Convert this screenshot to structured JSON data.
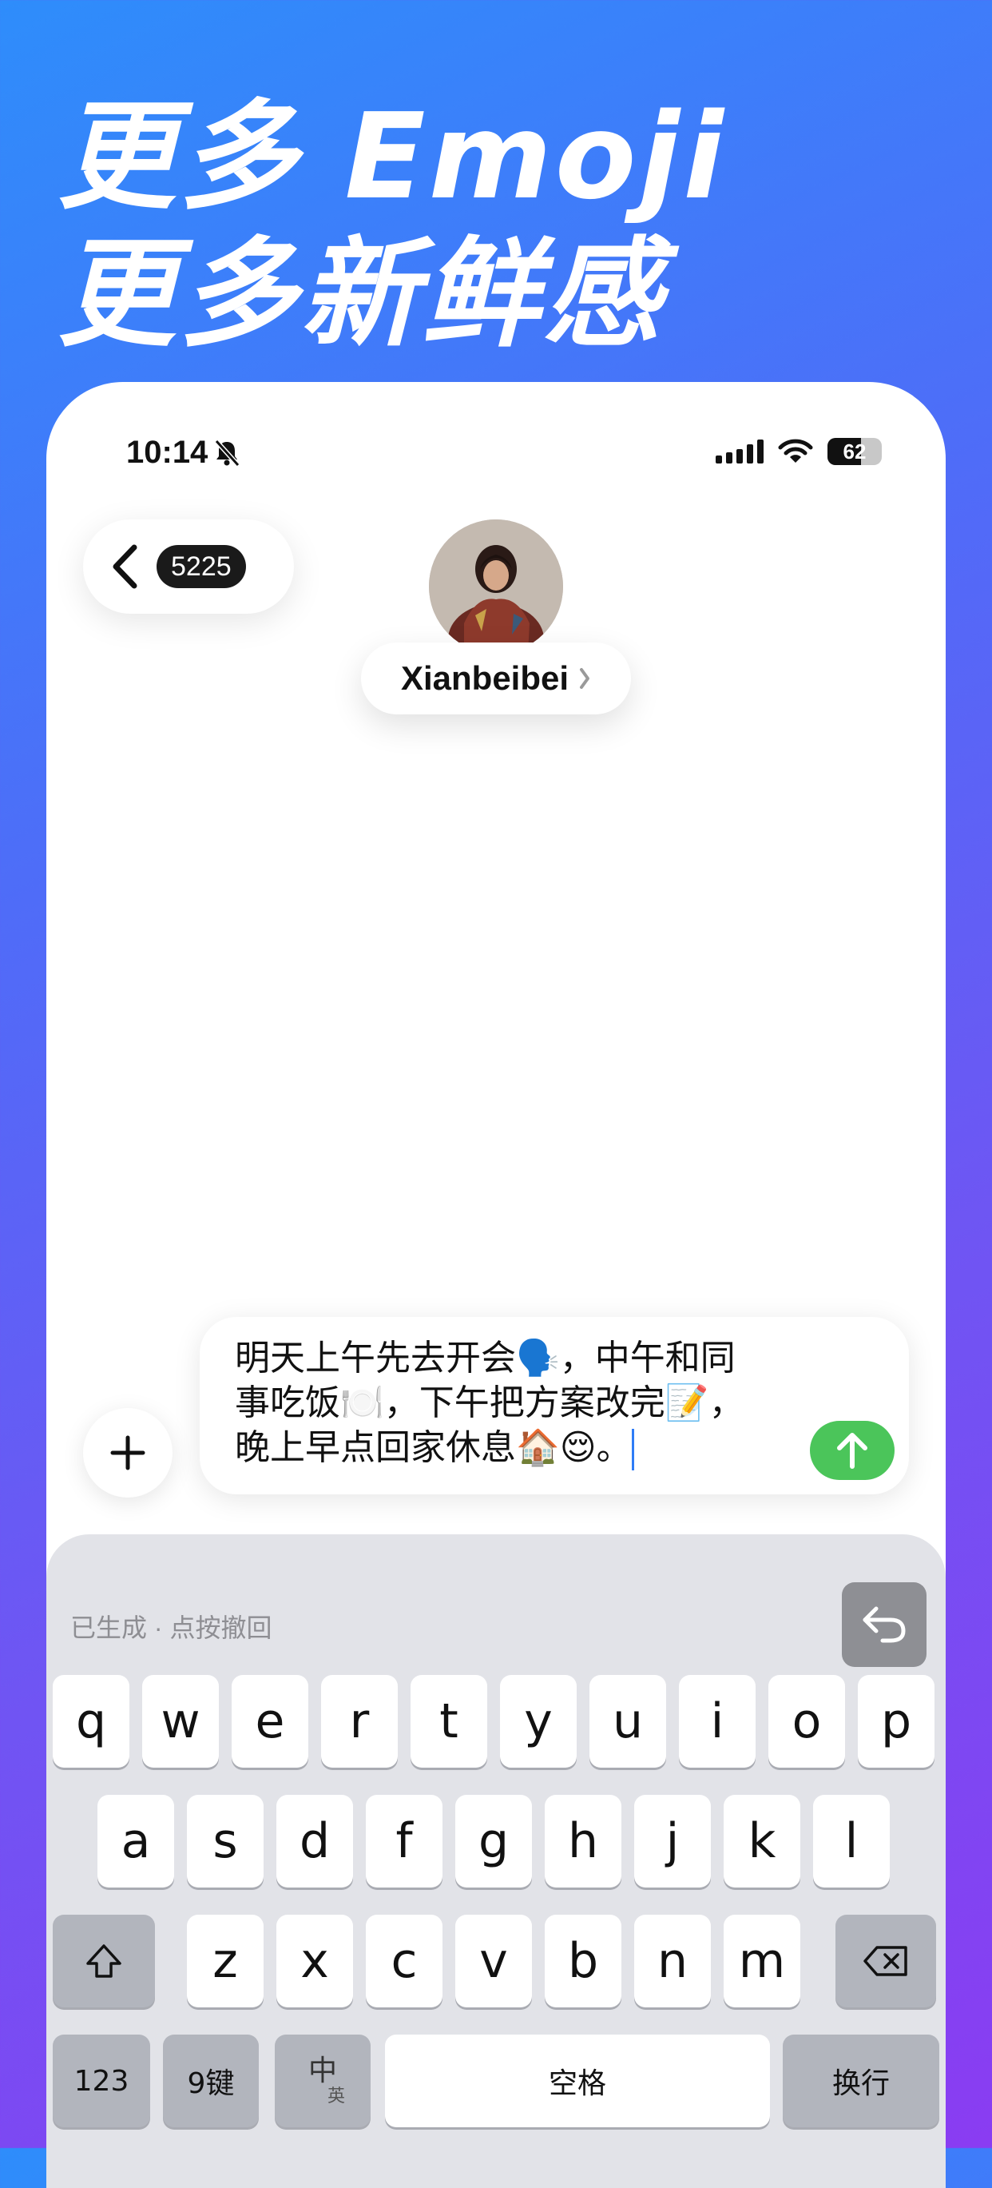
{
  "headline": {
    "line1": "更多 Emoji",
    "line2": "更多新鲜感"
  },
  "status_bar": {
    "time": "10:14",
    "battery": "62",
    "battery_level": 0.62
  },
  "header": {
    "unread_count": "5225",
    "contact_name": "Xianbeibei",
    "icons": {
      "back": "chevron-left-icon",
      "name_chevron": "chevron-right-icon"
    }
  },
  "composer": {
    "lines": [
      "明天上午先去开会🗣️，中午和同",
      "事吃饭🍽️，下午把方案改完📝，",
      "晚上早点回家休息🏠😌。"
    ],
    "send_color": "#4bc55a",
    "icons": {
      "add": "plus-icon",
      "send": "arrow-up-icon"
    }
  },
  "keyboard": {
    "status_text": "已生成 · 点按撤回",
    "row1": [
      "q",
      "w",
      "e",
      "r",
      "t",
      "y",
      "u",
      "i",
      "o",
      "p"
    ],
    "row2": [
      "a",
      "s",
      "d",
      "f",
      "g",
      "h",
      "j",
      "k",
      "l"
    ],
    "row3": [
      "z",
      "x",
      "c",
      "v",
      "b",
      "n",
      "m"
    ],
    "bottom": {
      "numbers": "123",
      "nine_key": "9键",
      "lang_main": "中",
      "lang_sub": "英",
      "space": "空格",
      "return": "换行"
    },
    "icons": {
      "undo": "undo-icon",
      "shift": "shift-icon",
      "delete": "delete-icon"
    }
  }
}
